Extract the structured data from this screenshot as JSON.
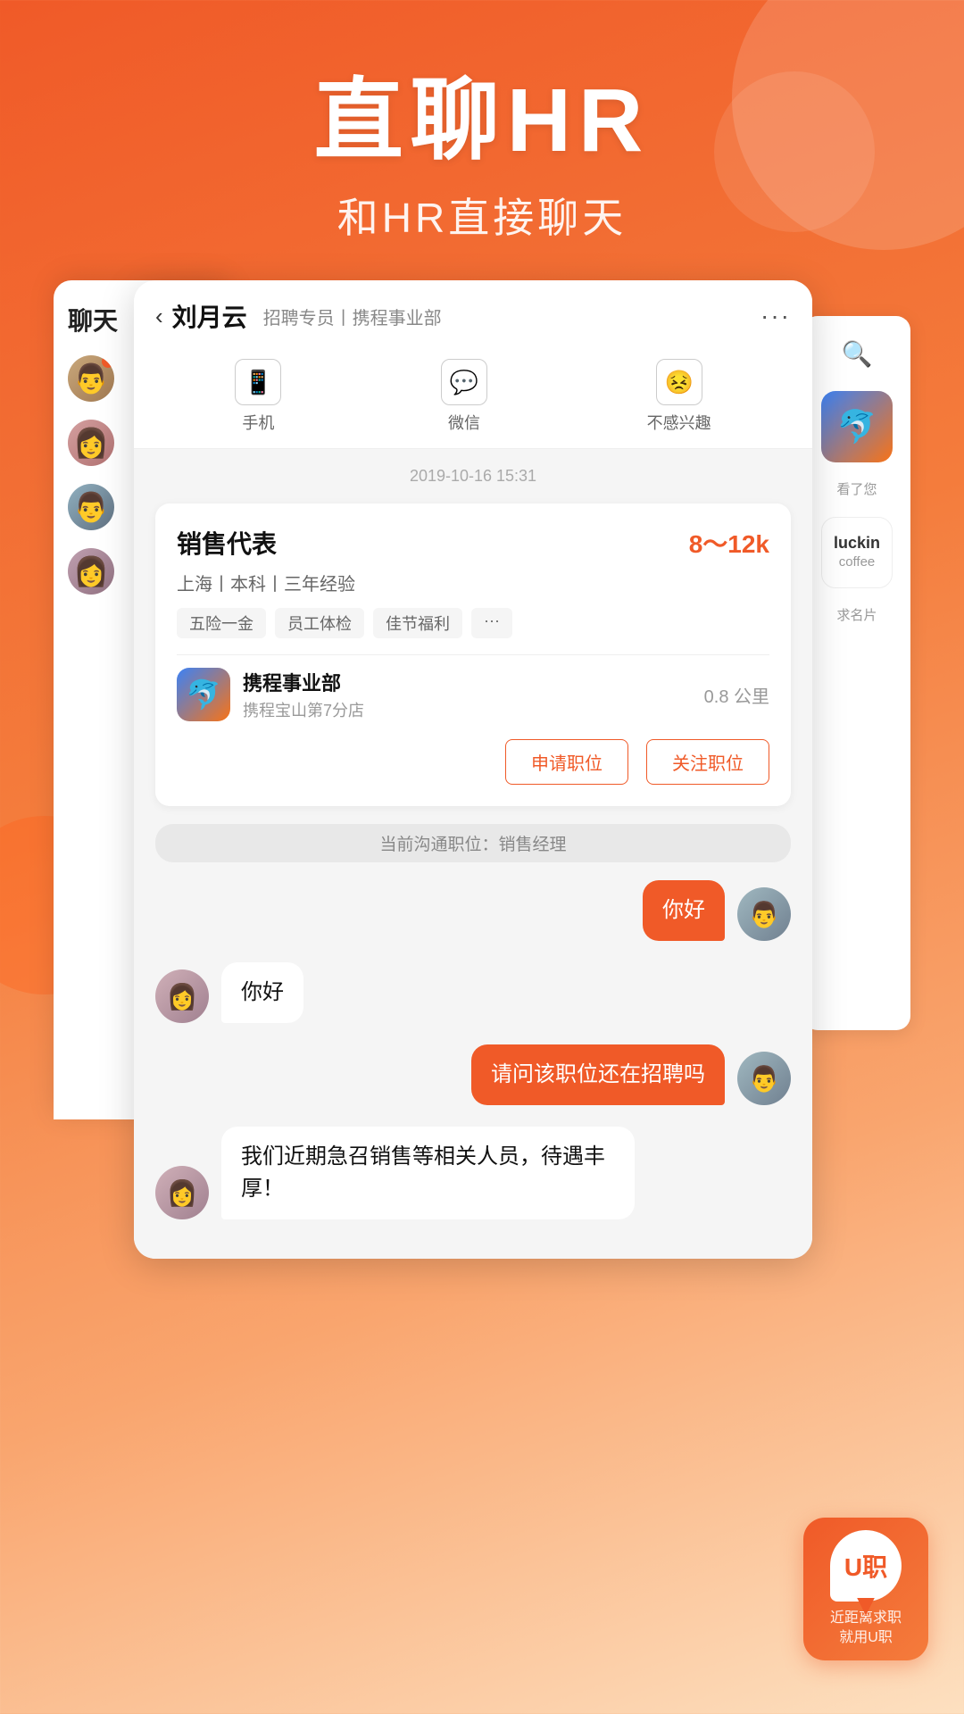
{
  "hero": {
    "title": "直聊HR",
    "subtitle": "和HR直接聊天"
  },
  "chat_header": {
    "back_label": "‹",
    "person_name": "刘月云",
    "person_role": "招聘专员丨携程事业部",
    "more_btn": "···",
    "actions": [
      {
        "icon": "📱",
        "label": "手机"
      },
      {
        "icon": "💬",
        "label": "微信"
      },
      {
        "icon": "😣",
        "label": "不感兴趣"
      }
    ]
  },
  "chat_timestamp": "2019-10-16 15:31",
  "job_card": {
    "title": "销售代表",
    "salary": "8～12k",
    "meta": "上海丨本科丨三年经验",
    "tags": [
      "五险一金",
      "员工体检",
      "佳节福利",
      "···"
    ],
    "company_name": "携程事业部",
    "company_branch": "携程宝山第7分店",
    "distance": "0.8 公里",
    "btn_apply": "申请职位",
    "btn_follow": "关注职位"
  },
  "current_position_label": "当前沟通职位：销售经理",
  "messages": [
    {
      "type": "sent",
      "text": "你好"
    },
    {
      "type": "received",
      "text": "你好"
    },
    {
      "type": "sent",
      "text": "请问该职位还在招聘吗"
    },
    {
      "type": "received",
      "text": "我们近期急召销售等相关人员，待遇丰厚！"
    }
  ],
  "chat_list": {
    "title": "聊天",
    "items": [
      {
        "face": "face-1"
      },
      {
        "face": "face-2"
      },
      {
        "face": "face-3"
      },
      {
        "face": "face-4"
      }
    ]
  },
  "right_panel": {
    "search_icon": "🔍",
    "viewed_text": "看了您",
    "card_text": "求名片",
    "coffee_text": "coffee"
  },
  "ujob_badge": {
    "logo_text": "U职",
    "label_line1": "近距离求职",
    "label_line2": "就用U职"
  }
}
